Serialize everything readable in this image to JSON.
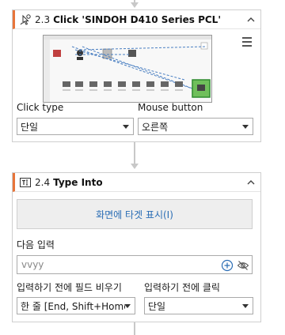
{
  "card1": {
    "number": "2.3",
    "title": "Click 'SINDOH D410 Series PCL'",
    "click_type_label": "Click type",
    "click_type_value": "단일",
    "mouse_button_label": "Mouse button",
    "mouse_button_value": "오른쪽"
  },
  "card2": {
    "number": "2.4",
    "title": "Type Into",
    "show_target_label": "화면에 타겟 표시(I)",
    "next_input_label": "다음 입력",
    "input_value": "vvyy",
    "clear_before_label": "입력하기 전에 필드 비우기",
    "clear_before_value": "한 줄 [End, Shift+Home",
    "click_before_label": "입력하기 전에 클릭",
    "click_before_value": "단일"
  },
  "colors": {
    "accent": "#e8753a",
    "link": "#2a6db5"
  },
  "icons": [
    "click-activity-icon",
    "collapse-icon",
    "menu-icon",
    "type-into-icon",
    "add-icon",
    "hide-icon"
  ]
}
